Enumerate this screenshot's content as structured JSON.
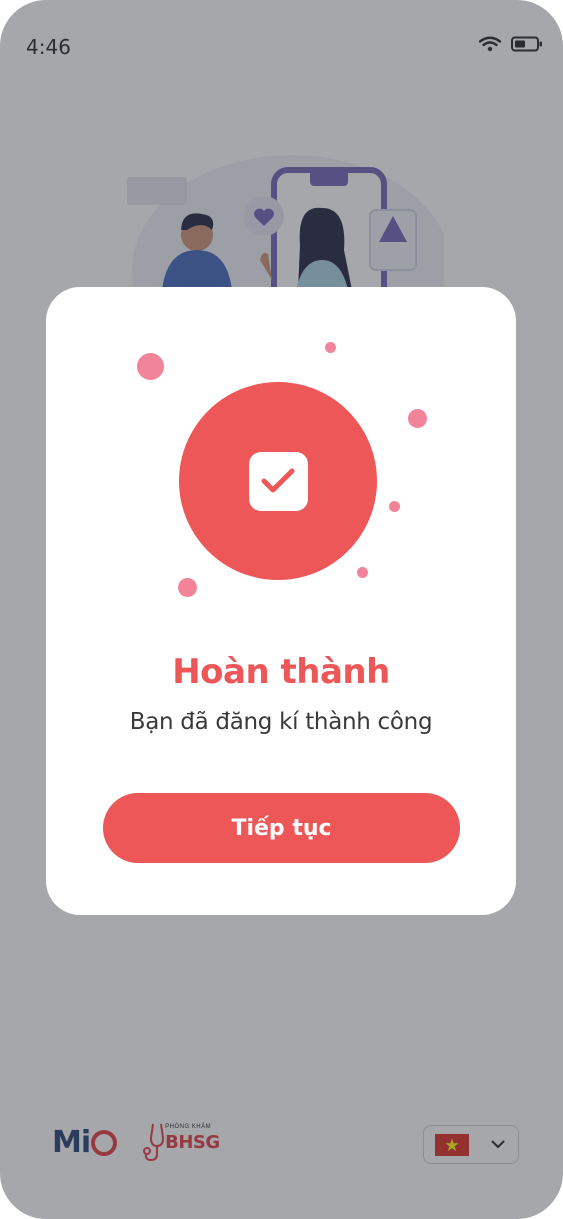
{
  "status_bar": {
    "time": "4:46",
    "wifi_icon": "wifi-icon",
    "battery_icon": "battery-icon",
    "battery_level": 0.5
  },
  "illustration": {
    "icon": "two-people-with-phone-illustration"
  },
  "modal": {
    "icon": "checkbox-checked-icon",
    "title": "Hoàn thành",
    "message": "Bạn đã đăng kí thành công",
    "button_label": "Tiếp tục"
  },
  "footer": {
    "logo_mio_prefix": "Mi",
    "logo_bhsg_caption": "PHÒNG KHÁM",
    "logo_bhsg_name": "BHSG",
    "language_flag": "vietnam-flag-icon",
    "language_dropdown_icon": "chevron-down-icon"
  },
  "colors": {
    "accent": "#ED5757",
    "accent_light": "#F2849A",
    "overlay": "#A6A7AB",
    "text_dark": "#3A3A3C"
  }
}
